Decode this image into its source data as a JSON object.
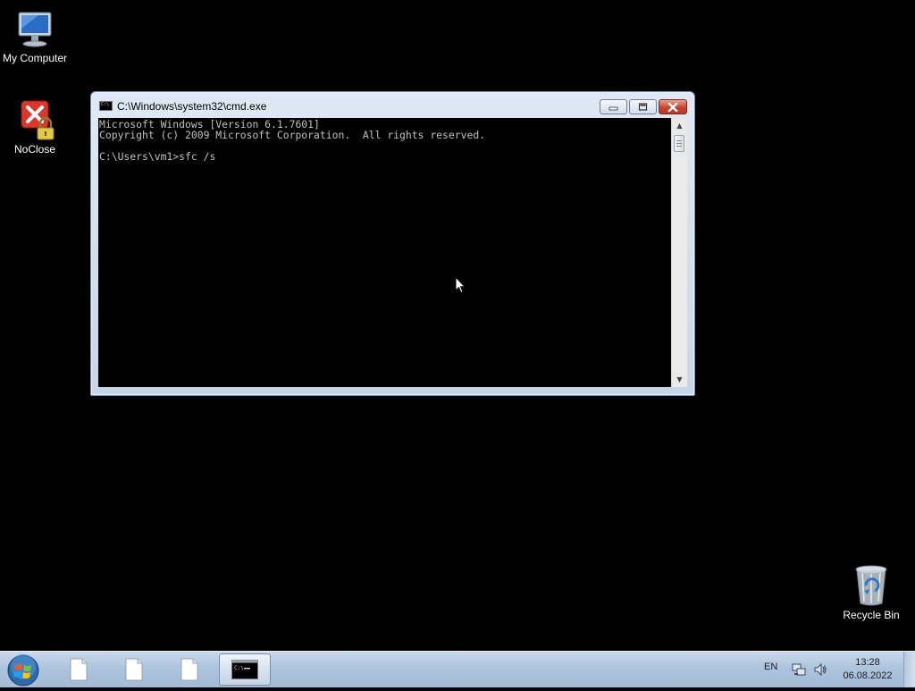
{
  "desktop": {
    "icons": [
      {
        "label": "My Computer",
        "icon": "computer-icon"
      },
      {
        "label": "NoClose",
        "icon": "noclose-lock-icon"
      },
      {
        "label": "Recycle Bin",
        "icon": "recycle-bin-icon"
      }
    ]
  },
  "window": {
    "title": "C:\\Windows\\system32\\cmd.exe",
    "icon": "cmd-icon",
    "console_lines": [
      "Microsoft Windows [Version 6.1.7601]",
      "Copyright (c) 2009 Microsoft Corporation.  All rights reserved.",
      "",
      "C:\\Users\\vm1>sfc /s"
    ]
  },
  "taskbar": {
    "start_icon": "windows-start-orb-icon",
    "buttons": [
      {
        "icon": "document-icon",
        "active": false
      },
      {
        "icon": "document-icon",
        "active": false
      },
      {
        "icon": "document-icon",
        "active": false
      },
      {
        "icon": "cmd-icon",
        "active": true
      }
    ],
    "tray": {
      "language": "EN",
      "network_icon": "network-icon",
      "volume_icon": "speaker-icon",
      "time": "13:28",
      "date": "06.08.2022"
    }
  },
  "colors": {
    "desktop_bg": "#000000",
    "console_text": "#c0c0c0",
    "close_button": "#c6462f"
  }
}
